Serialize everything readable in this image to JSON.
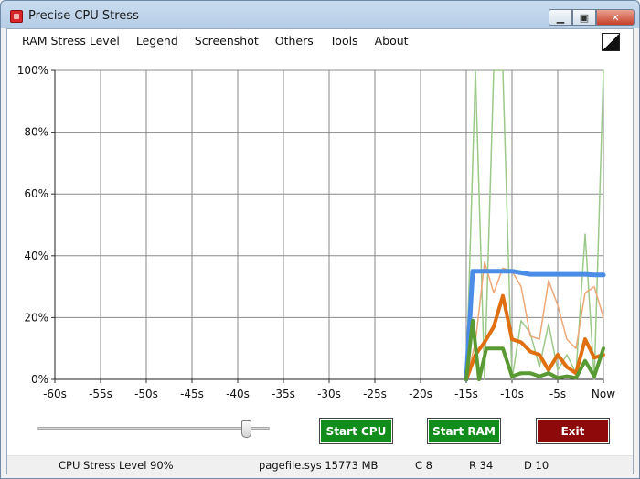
{
  "window": {
    "title": "Precise CPU Stress"
  },
  "menu": [
    {
      "label": "RAM Stress Level"
    },
    {
      "label": "Legend"
    },
    {
      "label": "Screenshot"
    },
    {
      "label": "Others"
    },
    {
      "label": "Tools"
    },
    {
      "label": "About"
    }
  ],
  "chart_data": {
    "type": "line",
    "x_tick_labels": [
      "-60s",
      "-55s",
      "-50s",
      "-45s",
      "-40s",
      "-35s",
      "-30s",
      "-25s",
      "-20s",
      "-15s",
      "-10s",
      "-5s",
      "Now"
    ],
    "y_tick_labels": [
      "0%",
      "20%",
      "40%",
      "60%",
      "80%",
      "100%"
    ],
    "xlim": [
      -60,
      0
    ],
    "ylim": [
      0,
      100
    ],
    "grid": true,
    "colors": {
      "blue_thick": "#4b8de6",
      "orange_thick": "#e0700f",
      "orange_thin": "#eea877",
      "green_thick": "#5a9a32",
      "green_thin": "#9cc98a"
    },
    "series": [
      {
        "color_key": "green_thin",
        "width": 1.5,
        "x": [
          -15,
          -14,
          -13,
          -12,
          -11,
          -10,
          -9,
          -8,
          -7,
          -6,
          -5,
          -4,
          -3,
          -2,
          -1,
          0
        ],
        "y": [
          0,
          100,
          0,
          100,
          100,
          0,
          19,
          15,
          4,
          18,
          3,
          8,
          2,
          47,
          0,
          100
        ]
      },
      {
        "color_key": "orange_thin",
        "width": 1.5,
        "x": [
          -15,
          -14,
          -13,
          -12,
          -11,
          -10,
          -9,
          -8,
          -7,
          -6,
          -5,
          -4,
          -3,
          -2,
          -1,
          0
        ],
        "y": [
          0,
          12,
          38,
          28,
          36,
          35,
          30,
          14,
          13,
          32,
          24,
          13,
          10,
          28,
          30,
          20
        ]
      },
      {
        "color_key": "blue_thick",
        "width": 5,
        "x": [
          -15,
          -14.3,
          -13,
          -12,
          -11,
          -10,
          -9,
          -8,
          -7,
          -6,
          -5,
          -4,
          -3,
          -2,
          -1,
          0
        ],
        "y": [
          0,
          35,
          35,
          35,
          35,
          35,
          34.5,
          34,
          34,
          34,
          34,
          34,
          34,
          34,
          33.8,
          33.8
        ]
      },
      {
        "color_key": "orange_thick",
        "width": 4,
        "x": [
          -15,
          -14,
          -13,
          -12,
          -11,
          -10,
          -9,
          -8,
          -7,
          -6,
          -5,
          -4,
          -3,
          -2,
          -1,
          0
        ],
        "y": [
          0,
          8,
          12,
          17,
          27,
          13,
          12,
          9,
          8,
          3,
          8,
          4,
          2,
          13,
          7,
          8
        ]
      },
      {
        "color_key": "green_thick",
        "width": 4,
        "x": [
          -15,
          -14.3,
          -13.6,
          -12.8,
          -12,
          -11,
          -10,
          -9,
          -8,
          -7,
          -6,
          -5,
          -4,
          -3,
          -2,
          -1,
          0
        ],
        "y": [
          0,
          19,
          0,
          10,
          10,
          10,
          1,
          2,
          2,
          1,
          2,
          0.5,
          1,
          0.5,
          6,
          1,
          10
        ]
      }
    ]
  },
  "controls": {
    "slider_value_fraction": 0.9,
    "start_cpu_label": "Start CPU",
    "start_ram_label": "Start RAM",
    "exit_label": "Exit"
  },
  "status": {
    "cpu_level": "CPU Stress Level 90%",
    "pagefile": "pagefile.sys 15773 MB",
    "c": "C 8",
    "r": "R 34",
    "d": "D 10"
  }
}
